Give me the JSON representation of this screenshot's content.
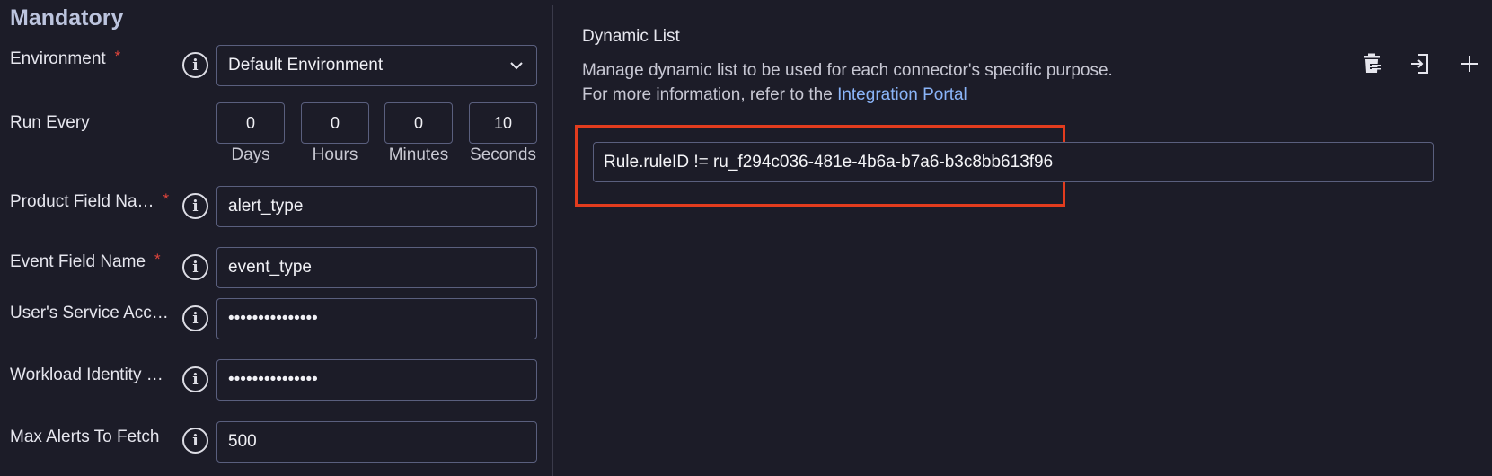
{
  "left_panel": {
    "section_title": "Mandatory",
    "fields": [
      {
        "label": "Environment",
        "required": "*",
        "value": "Default Environment"
      },
      {
        "label": "Run Every"
      },
      {
        "label": "Product Field Na…",
        "required": "*",
        "value": "alert_type"
      },
      {
        "label": "Event Field Name",
        "required": "*",
        "value": "event_type"
      },
      {
        "label": "User's Service Acc…",
        "value": "•••••••••••••••"
      },
      {
        "label": "Workload Identity …",
        "value": "•••••••••••••••"
      },
      {
        "label": "Max Alerts To Fetch",
        "value": "500"
      }
    ],
    "run_every": [
      {
        "value": "0",
        "unit": "Days"
      },
      {
        "value": "0",
        "unit": "Hours"
      },
      {
        "value": "0",
        "unit": "Minutes"
      },
      {
        "value": "10",
        "unit": "Seconds"
      }
    ],
    "info_glyph": "i"
  },
  "right_panel": {
    "title": "Dynamic List",
    "description_line1": "Manage dynamic list to be used for each connector's specific purpose.",
    "description_line2_prefix": "For more information, refer to the ",
    "description_link": "Integration Portal",
    "list_value": "Rule.ruleID != ru_f294c036-481e-4b6a-b7a6-b3c8bb613f96",
    "toolbar_icons": [
      "delete-list-icon",
      "import-icon",
      "add-icon"
    ]
  },
  "colors": {
    "background": "#1c1c28",
    "accent_link": "#8ab4f8",
    "required_star": "#e2453c",
    "highlight_box": "#e23c1e"
  }
}
